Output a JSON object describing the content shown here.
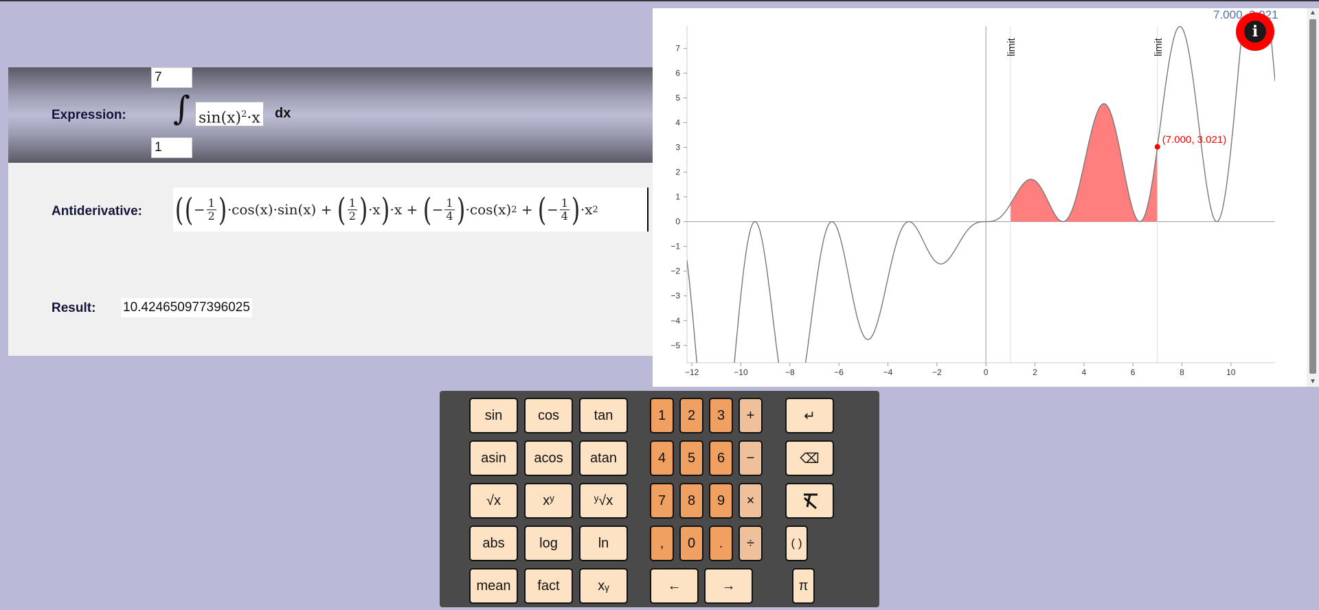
{
  "expression": {
    "label": "Expression:",
    "upper_bound": "7",
    "lower_bound": "1",
    "integrand_base": "sin(x)",
    "integrand_exp": "2",
    "integrand_tail": "·x",
    "dx": "dx"
  },
  "antiderivative": {
    "label": "Antiderivative:",
    "cos": "cos(x)",
    "sin": "sin(x)",
    "x": "x",
    "half_n": "1",
    "half_d": "2",
    "quarter_n": "1",
    "quarter_d": "4",
    "dot": "·",
    "minus": "−",
    "plus": "+",
    "exp2": "2"
  },
  "result": {
    "label": "Result:",
    "value": "10.424650977396025"
  },
  "panel_edge": {
    "top": "7",
    "bottom": "1"
  },
  "graph": {
    "top_coord": "7.000, 3.021",
    "info_icon": "i"
  },
  "chart_data": {
    "type": "line",
    "function": "sin(x)^2·x",
    "x_ticks": [
      -12,
      -10,
      -8,
      -6,
      -4,
      -2,
      0,
      2,
      4,
      6,
      8,
      10
    ],
    "y_ticks": [
      -5,
      -4,
      -3,
      -2,
      -1,
      0,
      1,
      2,
      3,
      4,
      5,
      6,
      7
    ],
    "xlim": [
      -12.2,
      11.8
    ],
    "ylim": [
      -5.7,
      7.9
    ],
    "shaded_from": 1,
    "shaded_to": 7,
    "limit_lines": [
      {
        "x": 1,
        "label": "limit"
      },
      {
        "x": 7,
        "label": "limit"
      }
    ],
    "point": {
      "x": 7,
      "y": 3.021,
      "label": "(7.000, 3.021)"
    },
    "colors": {
      "curve": "#777777",
      "fill": "#ff7f7f",
      "point": "#ff0000",
      "axis": "#999999"
    }
  },
  "keypad": {
    "functions": [
      [
        "sin",
        "cos",
        "tan"
      ],
      [
        "asin",
        "acos",
        "atan"
      ],
      [
        "√x",
        "xʸ",
        "ʸ√x"
      ],
      [
        "abs",
        "log",
        "ln"
      ],
      [
        "mean",
        "fact",
        "xᵧ"
      ]
    ],
    "numbers": [
      [
        "1",
        "2",
        "3"
      ],
      [
        "4",
        "5",
        "6"
      ],
      [
        "7",
        "8",
        "9"
      ],
      [
        ",",
        "0",
        "."
      ]
    ],
    "operators": [
      "+",
      "−",
      "×",
      "÷"
    ],
    "actions": {
      "enter_icon": "↵",
      "backspace_icon": "⌫",
      "clear_icon": "clear-format-icon",
      "parens": "( )",
      "pi": "π",
      "left": "←",
      "right": "→"
    }
  }
}
